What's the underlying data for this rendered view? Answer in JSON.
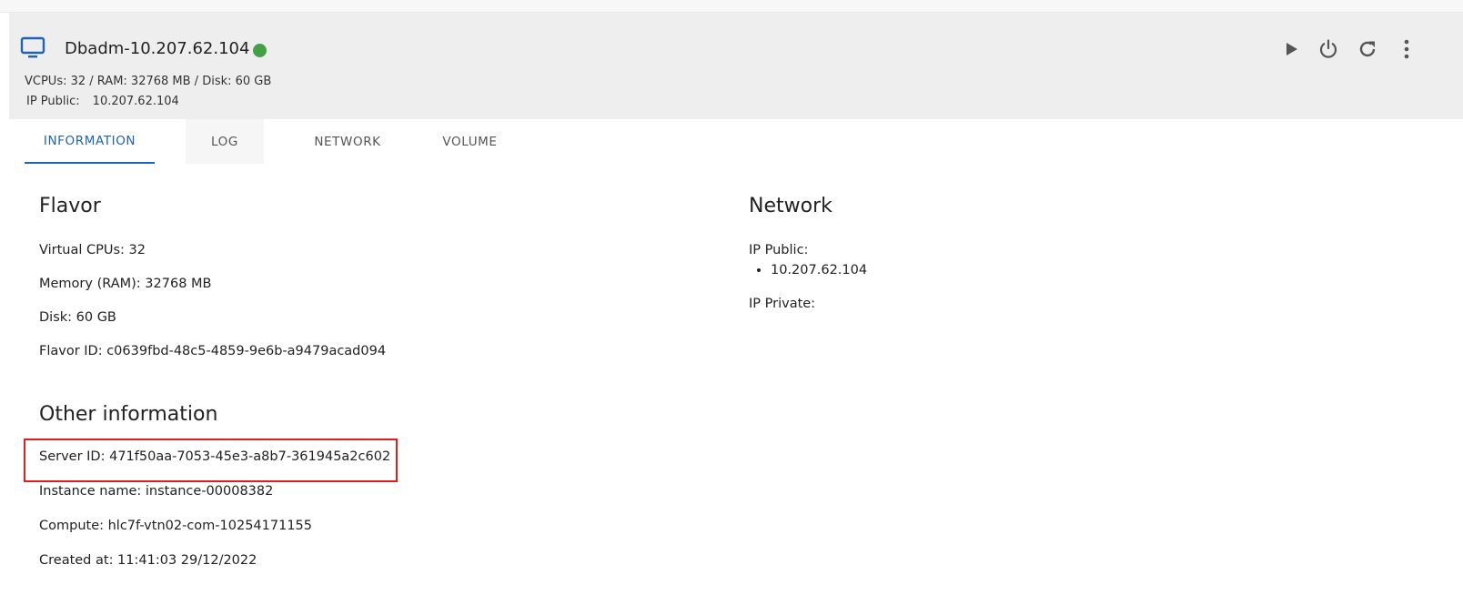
{
  "server": {
    "name": "Dbadm-10.207.62.104",
    "status_color": "#43a047",
    "specs": "VCPUs: 32 / RAM: 32768 MB / Disk: 60 GB",
    "ip_public_label": "IP Public:",
    "ip_public_value": "10.207.62.104"
  },
  "actions": {
    "start_icon": "play-icon",
    "power_icon": "power-icon",
    "reboot_icon": "refresh-icon",
    "more_icon": "more-vert-icon"
  },
  "tabs": [
    {
      "label": "INFORMATION",
      "active": true
    },
    {
      "label": "LOG",
      "active": false
    },
    {
      "label": "NETWORK",
      "active": false
    },
    {
      "label": "VOLUME",
      "active": false
    }
  ],
  "flavor": {
    "title": "Flavor",
    "items": [
      "Virtual CPUs: 32",
      "Memory (RAM): 32768 MB",
      "Disk: 60 GB",
      "Flavor ID: c0639fbd-48c5-4859-9e6b-a9479acad094"
    ]
  },
  "other": {
    "title": "Other information",
    "items": [
      "Server ID: 471f50aa-7053-45e3-a8b7-361945a2c602",
      "Instance name: instance-00008382",
      "Compute: hlc7f-vtn02-com-10254171155",
      "Created at: 11:41:03 29/12/2022"
    ]
  },
  "network": {
    "title": "Network",
    "ip_public_label": "IP Public:",
    "ip_public_list": [
      "10.207.62.104"
    ],
    "ip_private_label": "IP Private:"
  },
  "colors": {
    "accent": "#1e63b5",
    "highlight": "#e01e1e",
    "header_bg": "#eeeeee"
  }
}
